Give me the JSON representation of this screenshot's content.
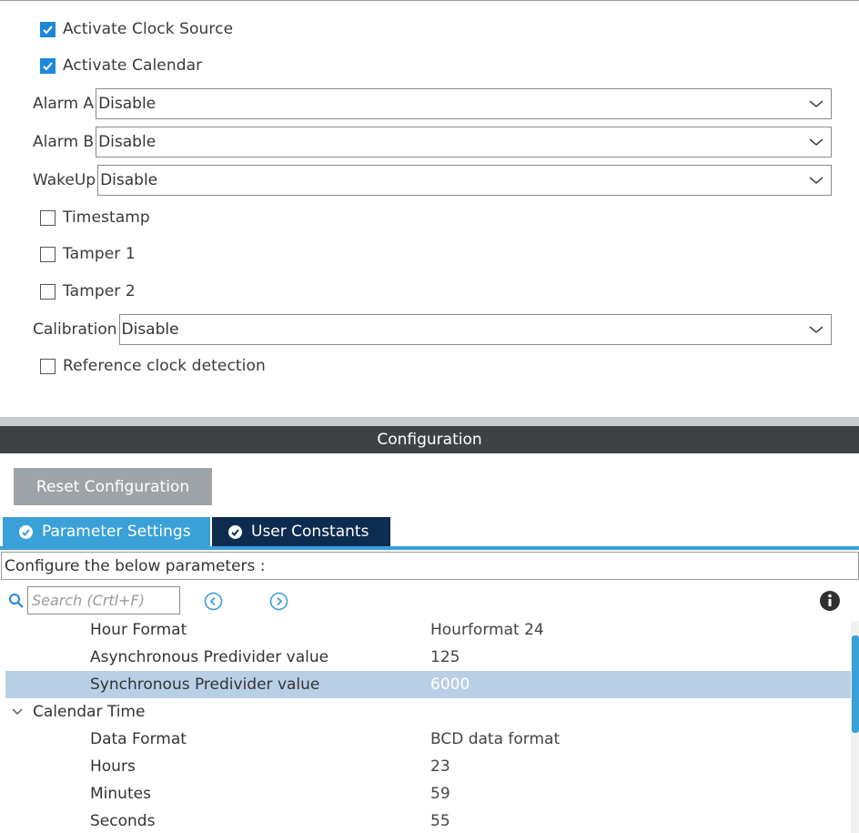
{
  "mode": {
    "activate_clock_source": {
      "label": "Activate Clock Source",
      "checked": true
    },
    "activate_calendar": {
      "label": "Activate Calendar",
      "checked": true
    },
    "alarm_a": {
      "label": "Alarm A",
      "value": "Disable"
    },
    "alarm_b": {
      "label": "Alarm B",
      "value": "Disable"
    },
    "wakeup": {
      "label": "WakeUp",
      "value": "Disable"
    },
    "timestamp": {
      "label": "Timestamp",
      "checked": false
    },
    "tamper1": {
      "label": "Tamper 1",
      "checked": false
    },
    "tamper2": {
      "label": "Tamper 2",
      "checked": false
    },
    "calibration": {
      "label": "Calibration",
      "value": "Disable"
    },
    "reference_clock": {
      "label": "Reference clock detection",
      "checked": false
    }
  },
  "configuration": {
    "title": "Configuration",
    "reset_label": "Reset Configuration",
    "tabs": [
      {
        "label": "Parameter Settings",
        "active": true
      },
      {
        "label": "User Constants",
        "active": false
      }
    ],
    "instruction": "Configure the below parameters :",
    "search": {
      "placeholder": "Search (Crtl+F)"
    }
  },
  "parameters": [
    {
      "name": "Hour Format",
      "value": "Hourformat 24"
    },
    {
      "name": "Asynchronous Predivider value",
      "value": "125"
    },
    {
      "name": "Synchronous Predivider value",
      "value": "6000",
      "selected": true
    },
    {
      "group": true,
      "name": "Calendar Time"
    },
    {
      "name": "Data Format",
      "value": "BCD data format"
    },
    {
      "name": "Hours",
      "value": "23"
    },
    {
      "name": "Minutes",
      "value": "59"
    },
    {
      "name": "Seconds",
      "value": "55"
    }
  ],
  "colors": {
    "accent": "#3aa0d8",
    "tab_inactive": "#0d2c4f",
    "header_bar": "#3f4245",
    "selected_row": "#b9cfe6",
    "checkbox": "#1e88d8"
  }
}
